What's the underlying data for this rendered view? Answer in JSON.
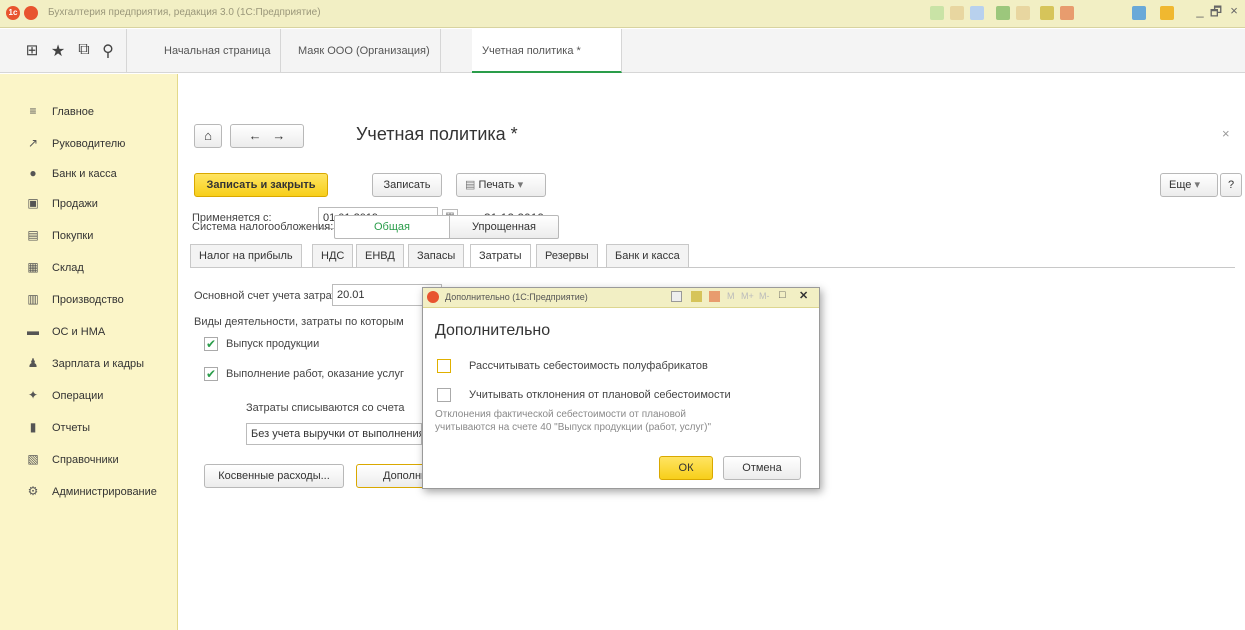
{
  "window": {
    "title": "Бухгалтерия предприятия, редакция 3.0  (1С:Предприятие)",
    "controls": [
      "_",
      "🗗",
      "×"
    ]
  },
  "tabs": [
    {
      "label": "Начальная страница"
    },
    {
      "label": "Маяк ООО (Организация)"
    },
    {
      "label": "Учетная политика *"
    }
  ],
  "sidebar": {
    "items": [
      {
        "label": "Главное",
        "icon": "≡"
      },
      {
        "label": "Руководителю",
        "icon": "↗"
      },
      {
        "label": "Банк и касса",
        "icon": "●"
      },
      {
        "label": "Продажи",
        "icon": "▣"
      },
      {
        "label": "Покупки",
        "icon": "▤"
      },
      {
        "label": "Склад",
        "icon": "▦"
      },
      {
        "label": "Производство",
        "icon": "▥"
      },
      {
        "label": "ОС и НМА",
        "icon": "▬"
      },
      {
        "label": "Зарплата и кадры",
        "icon": "♟"
      },
      {
        "label": "Операции",
        "icon": "✦"
      },
      {
        "label": "Отчеты",
        "icon": "▮"
      },
      {
        "label": "Справочники",
        "icon": "▧"
      },
      {
        "label": "Администрирование",
        "icon": "⚙"
      }
    ]
  },
  "form": {
    "title": "Учетная политика *",
    "save_close": "Записать и закрыть",
    "save": "Записать",
    "print": "Печать",
    "more": "Еще",
    "help": "?",
    "applies_label": "Применяется с:",
    "date_from": "01.01.2019",
    "to_label": "по:",
    "date_to": "31.12.2019",
    "tax_system_label": "Система налогообложения:",
    "tax_general": "Общая",
    "tax_simplified": "Упрощенная",
    "inner_tabs": [
      "Налог на прибыль",
      "НДС",
      "ЕНВД",
      "Запасы",
      "Затраты",
      "Резервы",
      "Банк и касса"
    ],
    "cost_account_label": "Основной счет учета затрат:",
    "cost_account_value": "20.01",
    "activities_label": "Виды деятельности, затраты по которым",
    "check_production": "Выпуск продукции",
    "check_services": "Выполнение работ, оказание услуг",
    "writeoff_label": "Затраты списываются со счета",
    "writeoff_value": "Без учета выручки от выполнения",
    "indirect_btn": "Косвенные расходы...",
    "additional_btn": "Дополнительно"
  },
  "dialog": {
    "title": "Дополнительно  (1С:Предприятие)",
    "heading": "Дополнительно",
    "opt1": "Рассчитывать себестоимость полуфабрикатов",
    "opt2": "Учитывать отклонения от плановой себестоимости",
    "note1": "Отклонения фактической себестоимости от плановой",
    "note2": "учитываются на счете 40 \"Выпуск продукции (работ, услуг)\"",
    "ok": "ОК",
    "cancel": "Отмена",
    "controls": [
      "M",
      "M+",
      "M-",
      "□",
      "✕"
    ]
  },
  "colors": {
    "sidebar_bg": "#fbf5c8",
    "accent_yellow": "#f7cf1a",
    "active_tab_green": "#2a9d4a"
  }
}
